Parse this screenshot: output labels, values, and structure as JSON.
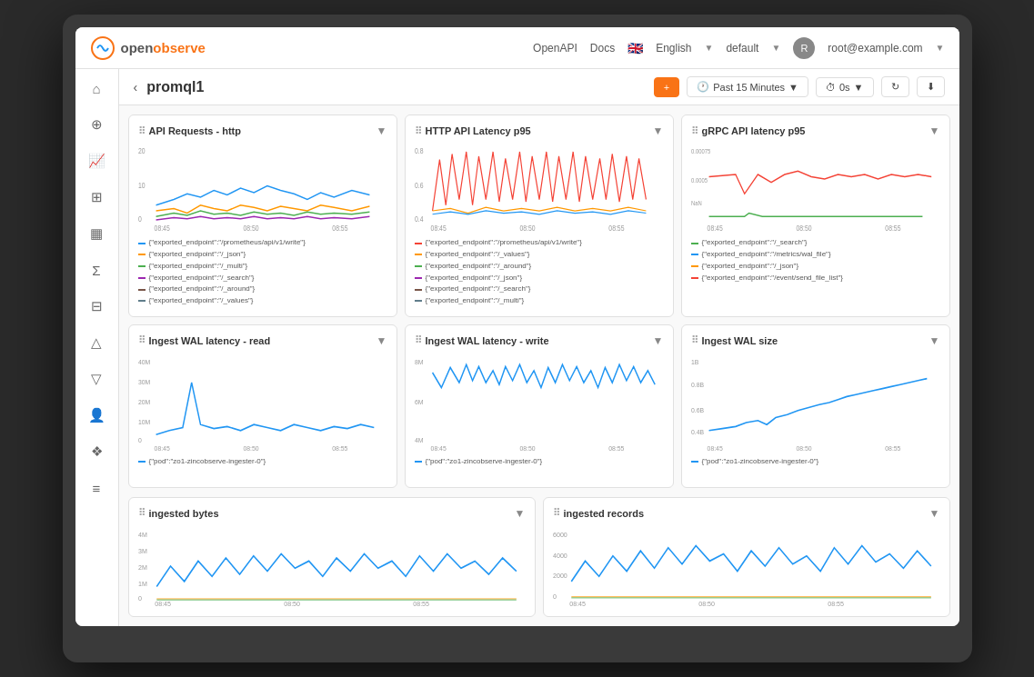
{
  "app": {
    "logo_open": "open",
    "logo_observe": "observe",
    "nav_openapi": "OpenAPI",
    "nav_docs": "Docs",
    "nav_language": "English",
    "nav_default": "default",
    "nav_user": "root@example.com"
  },
  "toolbar": {
    "back_label": "‹",
    "title": "promql1",
    "add_label": "+",
    "time_label": "Past 15 Minutes",
    "interval_label": "0s",
    "refresh_label": "↻",
    "download_label": "⬇"
  },
  "sidebar": {
    "items": [
      {
        "icon": "⌂",
        "label": "home-icon",
        "active": false
      },
      {
        "icon": "🔍",
        "label": "search-icon",
        "active": false
      },
      {
        "icon": "📈",
        "label": "metrics-icon",
        "active": true
      },
      {
        "icon": "⊞",
        "label": "dashboards-icon",
        "active": false
      },
      {
        "icon": "◈",
        "label": "logs-icon",
        "active": false
      },
      {
        "icon": "Σ",
        "label": "alerts-icon",
        "active": false
      },
      {
        "icon": "⊟",
        "label": "reports-icon",
        "active": false
      },
      {
        "icon": "△",
        "label": "traces-icon",
        "active": false
      },
      {
        "icon": "▼",
        "label": "filter-icon",
        "active": false
      },
      {
        "icon": "👤",
        "label": "user-icon",
        "active": false
      },
      {
        "icon": "❖",
        "label": "integration-icon",
        "active": false
      },
      {
        "icon": "≡",
        "label": "menu-icon",
        "active": false
      }
    ]
  },
  "panels": [
    {
      "id": "api-requests",
      "title": "API Requests - http",
      "y_labels": [
        "20",
        "10",
        "0"
      ],
      "x_labels": [
        "08:45",
        "08:50",
        "08:55"
      ],
      "legend": [
        {
          "color": "#2196F3",
          "text": "{\"exported_endpoint\":\"/prometheus/api/v1/write\"}"
        },
        {
          "color": "#FF9800",
          "text": "{\"exported_endpoint\":\"/_json\"}"
        },
        {
          "color": "#4CAF50",
          "text": "{\"exported_endpoint\":\"/_multi\"}"
        },
        {
          "color": "#9C27B0",
          "text": "{\"exported_endpoint\":\"/_search\"}"
        },
        {
          "color": "#795548",
          "text": "{\"exported_endpoint\":\"/_around\"}"
        },
        {
          "color": "#607D8B",
          "text": "{\"exported_endpoint\":\"/_values\"}"
        }
      ]
    },
    {
      "id": "http-api-latency",
      "title": "HTTP API Latency p95",
      "y_labels": [
        "0.8",
        "0.6",
        "0.4"
      ],
      "x_labels": [
        "08:45",
        "08:50",
        "08:55"
      ],
      "legend": [
        {
          "color": "#f44336",
          "text": "{\"exported_endpoint\":\"/prometheus/api/v1/write\"}"
        },
        {
          "color": "#FF9800",
          "text": "{\"exported_endpoint\":\"/_values\"}"
        },
        {
          "color": "#4CAF50",
          "text": "{\"exported_endpoint\":\"/_around\"}"
        },
        {
          "color": "#9C27B0",
          "text": "{\"exported_endpoint\":\"/_json\"}"
        },
        {
          "color": "#795548",
          "text": "{\"exported_endpoint\":\"/_search\"}"
        },
        {
          "color": "#607D8B",
          "text": "{\"exported_endpoint\":\"/_multi\"}"
        }
      ]
    },
    {
      "id": "grpc-api-latency",
      "title": "gRPC API latency p95",
      "y_labels": [
        "0.00075",
        "0.0005",
        "NaN"
      ],
      "x_labels": [
        "08:45",
        "08:50",
        "08:55"
      ],
      "legend": [
        {
          "color": "#4CAF50",
          "text": "{\"exported_endpoint\":\"/_search\"}"
        },
        {
          "color": "#2196F3",
          "text": "{\"exported_endpoint\":\"/metrics/wal_file\"}"
        },
        {
          "color": "#FF9800",
          "text": "{\"exported_endpoint\":\"/_json\"}"
        },
        {
          "color": "#f44336",
          "text": "{\"exported_endpoint\":\"/event/send_file_list\"}"
        }
      ]
    },
    {
      "id": "ingest-wal-read",
      "title": "Ingest WAL latency - read",
      "y_labels": [
        "40M",
        "30M",
        "20M",
        "10M",
        "0"
      ],
      "x_labels": [
        "08:45",
        "08:50",
        "08:55"
      ],
      "legend": [
        {
          "color": "#2196F3",
          "text": "{\"pod\":\"zo1-zincobserve-ingester-0\"}"
        }
      ]
    },
    {
      "id": "ingest-wal-write",
      "title": "Ingest WAL latency - write",
      "y_labels": [
        "8M",
        "6M",
        "4M"
      ],
      "x_labels": [
        "08:45",
        "08:50",
        "08:55"
      ],
      "legend": [
        {
          "color": "#2196F3",
          "text": "{\"pod\":\"zo1-zincobserve-ingester-0\"}"
        }
      ]
    },
    {
      "id": "ingest-wal-size",
      "title": "Ingest WAL size",
      "y_labels": [
        "1B",
        "0.8B",
        "0.6B",
        "0.4B"
      ],
      "x_labels": [
        "08:45",
        "08:50",
        "08:55"
      ],
      "legend": [
        {
          "color": "#2196F3",
          "text": "{\"pod\":\"zo1-zincobserve-ingester-0\"}"
        }
      ]
    }
  ],
  "bottom_panels": [
    {
      "id": "ingested-bytes",
      "title": "ingested bytes",
      "y_labels": [
        "4M",
        "3M",
        "2M",
        "1M",
        "0"
      ],
      "x_labels": [
        "08:45",
        "08:50",
        "08:55"
      ]
    },
    {
      "id": "ingested-records",
      "title": "ingested records",
      "y_labels": [
        "6000",
        "4000",
        "2000",
        "0"
      ],
      "x_labels": [
        "08:45",
        "08:50",
        "08:55"
      ]
    }
  ]
}
